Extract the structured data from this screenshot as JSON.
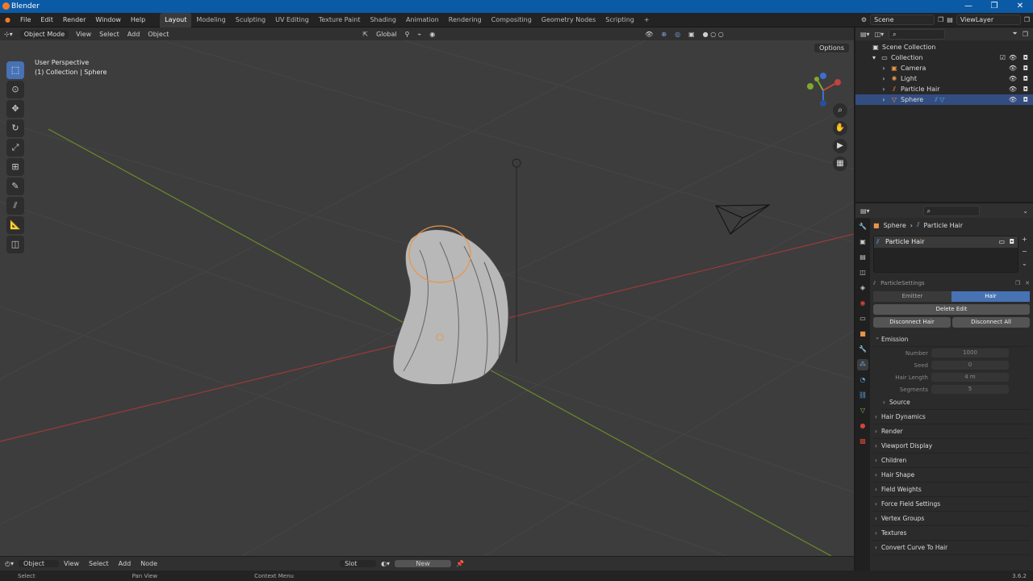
{
  "window": {
    "title": "Blender"
  },
  "menubar": {
    "menus": [
      "File",
      "Edit",
      "Render",
      "Window",
      "Help"
    ],
    "workspaces": [
      "Layout",
      "Modeling",
      "Sculpting",
      "UV Editing",
      "Texture Paint",
      "Shading",
      "Animation",
      "Rendering",
      "Compositing",
      "Geometry Nodes",
      "Scripting"
    ],
    "add_tab": "+",
    "scene": "Scene",
    "view_layer": "ViewLayer"
  },
  "viewport_header": {
    "mode": "Object Mode",
    "menus": [
      "View",
      "Select",
      "Add",
      "Object"
    ],
    "orientation": "Global",
    "options": "Options"
  },
  "viewport": {
    "perspective": "User Perspective",
    "collection_info": "(1) Collection | Sphere"
  },
  "bottom_header": {
    "type": "Object",
    "menus": [
      "View",
      "Select",
      "Add",
      "Node"
    ],
    "slot": "Slot",
    "new": "New"
  },
  "statusbar": {
    "select": "Select",
    "pan": "Pan View",
    "context": "Context Menu",
    "version": "3.6.2"
  },
  "outliner": {
    "root": "Scene Collection",
    "collection": "Collection",
    "items": [
      {
        "name": "Camera",
        "selected": false
      },
      {
        "name": "Light",
        "selected": false
      },
      {
        "name": "Particle Hair",
        "selected": false
      },
      {
        "name": "Sphere",
        "selected": true
      }
    ]
  },
  "properties": {
    "breadcrumb": {
      "object": "Sphere",
      "system": "Particle Hair"
    },
    "system_list": [
      "Particle Hair"
    ],
    "settings_name": "ParticleSettings",
    "type_tabs": {
      "emitter": "Emitter",
      "hair": "Hair",
      "active": "Hair"
    },
    "delete_edit": "Delete Edit",
    "disconnect_hair": "Disconnect Hair",
    "disconnect_all": "Disconnect All",
    "emission": {
      "title": "Emission",
      "fields": [
        {
          "label": "Number",
          "value": "1000"
        },
        {
          "label": "Seed",
          "value": "0"
        },
        {
          "label": "Hair Length",
          "value": "4 m"
        },
        {
          "label": "Segments",
          "value": "5"
        }
      ],
      "source": "Source"
    },
    "panels": [
      "Hair Dynamics",
      "Render",
      "Viewport Display",
      "Children",
      "Hair Shape",
      "Field Weights",
      "Force Field Settings",
      "Vertex Groups",
      "Textures",
      "Convert Curve To Hair"
    ]
  },
  "colors": {
    "accent": "#4772b3",
    "titlebar": "#0b5aa6",
    "selection": "#334d80",
    "x_axis": "#c0433f",
    "y_axis": "#7ea92e"
  }
}
